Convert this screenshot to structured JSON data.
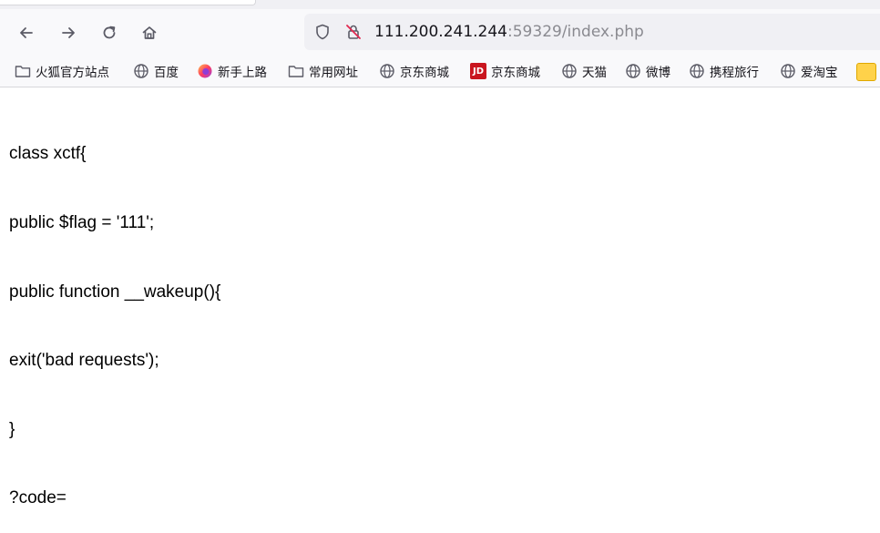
{
  "navbar": {
    "url_host": "111.200.241.244",
    "url_rest": ":59329/index.php"
  },
  "bookmarks": [
    {
      "label": "火狐官方站点",
      "icon": "folder-icon"
    },
    {
      "label": "百度",
      "icon": "globe-icon"
    },
    {
      "label": "新手上路",
      "icon": "firefox-icon"
    },
    {
      "label": "常用网址",
      "icon": "folder-icon"
    },
    {
      "label": "京东商城",
      "icon": "globe-icon"
    },
    {
      "label": "京东商城",
      "icon": "jd-icon",
      "icon_text": "JD"
    },
    {
      "label": "天猫",
      "icon": "globe-icon"
    },
    {
      "label": "微博",
      "icon": "globe-icon"
    },
    {
      "label": "携程旅行",
      "icon": "globe-icon"
    },
    {
      "label": "爱淘宝",
      "icon": "globe-icon"
    }
  ],
  "page": {
    "lines": [
      "class xctf{",
      "public $flag = '111';",
      "public function __wakeup(){",
      "exit('bad requests');",
      "}",
      "?code="
    ]
  },
  "colors": {
    "toolbar_bg": "#f9f9fb",
    "urlbar_bg": "#f0f0f4",
    "url_host": "#15141a",
    "url_rest": "#8a8a90",
    "jd_red": "#c9151e"
  }
}
